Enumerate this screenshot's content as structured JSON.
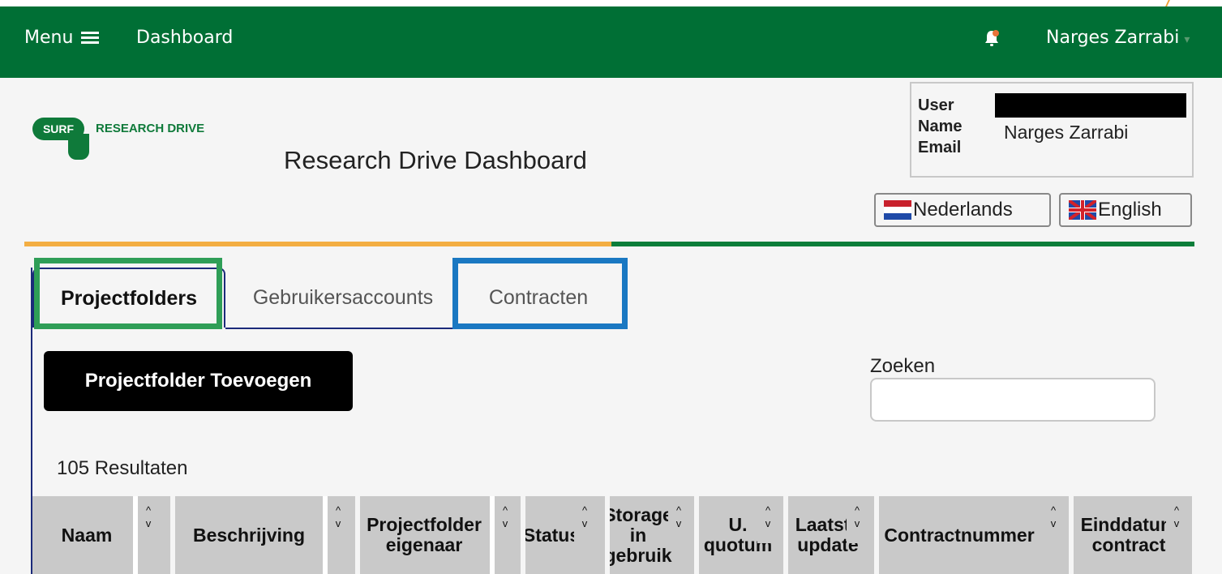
{
  "topbar": {
    "menu_label": "Menu",
    "dashboard_label": "Dashboard",
    "user_name": "Narges Zarrabi",
    "caret": "▾"
  },
  "logo": {
    "mark": "SURF",
    "text": "RESEARCH DRIVE"
  },
  "page": {
    "title": "Research Drive Dashboard"
  },
  "user_info": {
    "user_label": "User",
    "name_label": "Name",
    "email_label": "Email",
    "name_value": "Narges Zarrabi"
  },
  "languages": [
    {
      "label": "Nederlands"
    },
    {
      "label": "English"
    }
  ],
  "tabs": [
    {
      "label": "Projectfolders",
      "active": true
    },
    {
      "label": "Gebruikersaccounts",
      "active": false
    },
    {
      "label": "Contracten",
      "active": false
    }
  ],
  "actions": {
    "add_projectfolder": "Projectfolder Toevoegen"
  },
  "search": {
    "label": "Zoeken",
    "value": ""
  },
  "results": {
    "count_text": "105 Resultaten"
  },
  "table": {
    "columns": [
      {
        "label": "Naam",
        "sort_up": "^",
        "sort_down": "v"
      },
      {
        "label": "Beschrijving",
        "sort_up": "^",
        "sort_down": "v"
      },
      {
        "label": "Projectfolder eigenaar",
        "sort_up": "^",
        "sort_down": "v"
      },
      {
        "label": "Status",
        "sort_up": "^",
        "sort_down": "v"
      },
      {
        "label": "Storage in gebruik",
        "sort_up": "^",
        "sort_down": "v"
      },
      {
        "label": "U. quotum",
        "sort_up": "^",
        "sort_down": "v"
      },
      {
        "label": "Laatste update",
        "sort_up": "^",
        "sort_down": "v"
      },
      {
        "label": "Contractnummer",
        "sort_up": "^",
        "sort_down": "v"
      },
      {
        "label": "Einddatum contract",
        "sort_up": "^",
        "sort_down": "v"
      }
    ]
  },
  "colors": {
    "topbar": "#006f35",
    "accent_orange": "#f3ae43",
    "accent_green": "#0c7e3a",
    "highlight_green": "#2f9e57",
    "highlight_blue": "#1a78c2",
    "notification_dot": "#e8743a"
  },
  "icons": {
    "menu": "hamburger-icon",
    "notifications": "bell-icon",
    "nl_flag": "flag-nl-icon",
    "uk_flag": "flag-uk-icon"
  }
}
